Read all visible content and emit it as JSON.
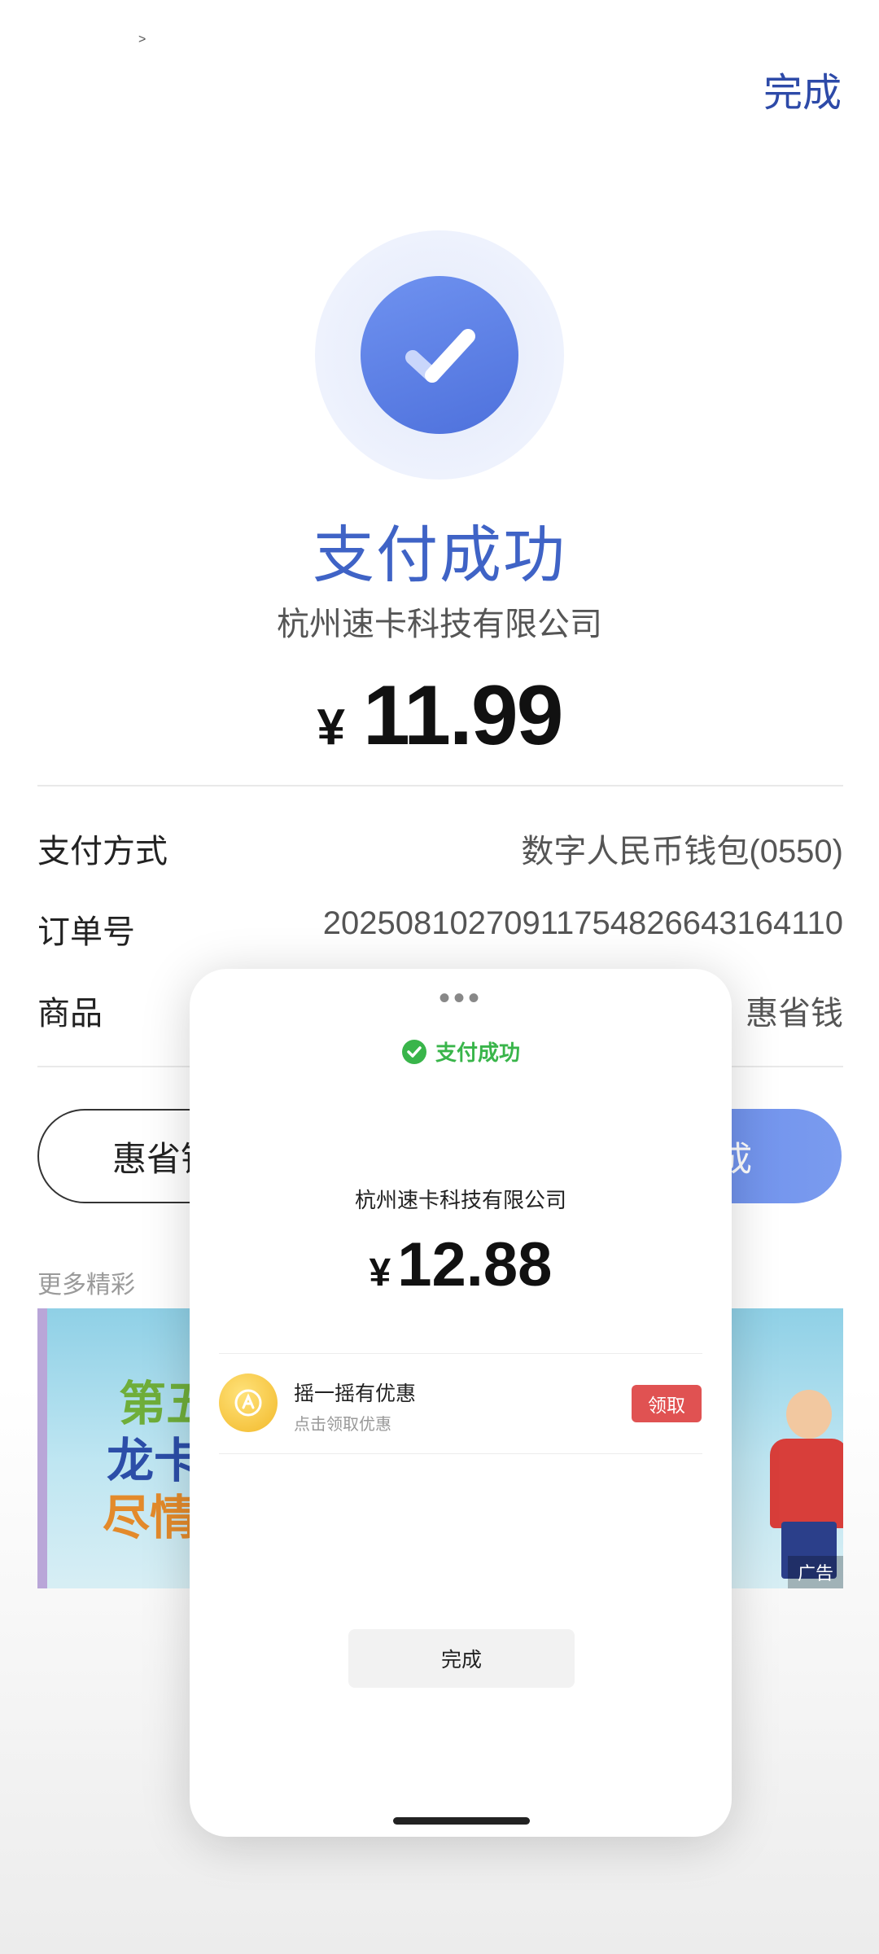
{
  "header": {
    "cursor_glyph": ">",
    "done_label": "完成"
  },
  "result": {
    "title": "支付成功",
    "merchant": "杭州速卡科技有限公司",
    "currency_symbol": "¥",
    "amount": "11.99"
  },
  "details": {
    "rows": [
      {
        "label": "支付方式",
        "value": "数字人民币钱包(0550)"
      },
      {
        "label": "订单号",
        "value": "202508102709117548266431641​10"
      },
      {
        "label": "商品",
        "value": "惠省钱"
      }
    ]
  },
  "actions": {
    "outline_label": "惠省钱",
    "filled_label": "完成"
  },
  "more": {
    "label": "更多精彩"
  },
  "banner": {
    "line1": "第五",
    "line2": "龙卡",
    "line3": "尽情",
    "ad_badge": "广告"
  },
  "sheet": {
    "dots": "•••",
    "status": "支付成功",
    "merchant": "杭州速卡科技有限公司",
    "currency_symbol": "¥",
    "amount": "12.88",
    "promo": {
      "title": "摇一摇有优惠",
      "subtitle": "点击领取优惠",
      "button": "领取"
    },
    "done_label": "完成"
  },
  "colors": {
    "accent_blue": "#3f63c6",
    "success_green": "#39b54a",
    "promo_red": "#e05252"
  },
  "icons": [
    "check-icon",
    "wechat-pay-check-icon",
    "coin-icon"
  ]
}
